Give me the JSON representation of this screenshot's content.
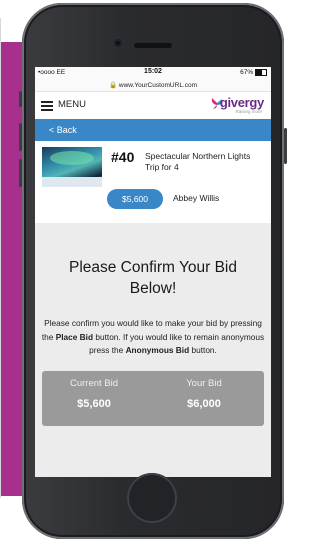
{
  "status_bar": {
    "carrier": "•oooo EE",
    "time": "15:02",
    "battery": "67%",
    "url": "www.YourCustomURL.com"
  },
  "nav": {
    "menu_label": "MENU",
    "logo_text": "givergy",
    "logo_tagline": "Raising more"
  },
  "back_bar": {
    "label": "< Back"
  },
  "auction_item": {
    "lot_number": "#40",
    "title": "Spectacular Northern Lights Trip for 4",
    "current_bid_badge": "$5,600",
    "bidder_name": "Abbey Willis"
  },
  "confirm": {
    "title": "Please Confirm Your Bid Below!",
    "text_part1": "Please confirm you would like to make your bid by pressing the ",
    "text_bold1": "Place Bid",
    "text_part2": " button. If you would like to remain anonymous press the ",
    "text_bold2": "Anonymous Bid",
    "text_part3": " button."
  },
  "bid_summary": {
    "current_label": "Current Bid",
    "current_value": "$5,600",
    "your_label": "Your Bid",
    "your_value": "$6,000"
  },
  "colors": {
    "accent_blue": "#3a87c8",
    "brand_purple": "#6a2b87",
    "bid_panel": "#9a9a9a"
  }
}
